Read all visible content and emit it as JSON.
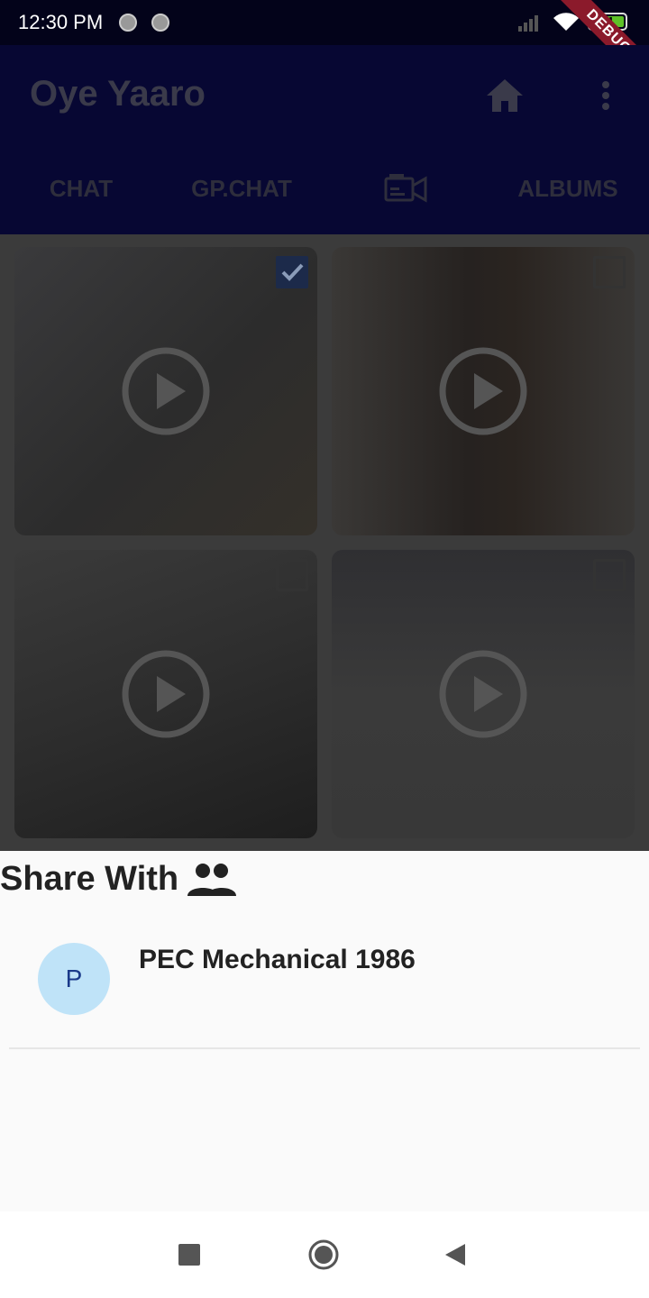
{
  "status_bar": {
    "time": "12:30 PM",
    "battery": "91",
    "debug_ribbon": "DEBUG"
  },
  "app_bar": {
    "title": "Oye Yaaro",
    "home_icon": "home-icon",
    "more_icon": "more-vert-icon"
  },
  "tabs": [
    {
      "label": "CHAT"
    },
    {
      "label": "GP.CHAT"
    },
    {
      "label": "",
      "icon": "video-tab-icon",
      "selected": true
    },
    {
      "label": "ALBUMS"
    }
  ],
  "videos": [
    {
      "checked": true,
      "icon": "play-icon"
    },
    {
      "checked": false,
      "icon": "play-icon"
    },
    {
      "checked": false,
      "icon": "play-icon"
    },
    {
      "checked": false,
      "icon": "play-icon"
    }
  ],
  "share": {
    "heading": "Share With",
    "icon": "people-icon",
    "contacts": [
      {
        "initial": "P",
        "name": "PEC Mechanical 1986"
      }
    ]
  },
  "colors": {
    "app_bar": "#070733",
    "status_bar": "#03031a",
    "avatar_bg": "#bfe3f8",
    "avatar_text": "#1a3a8a",
    "debug_ribbon": "#8b1a2b"
  }
}
